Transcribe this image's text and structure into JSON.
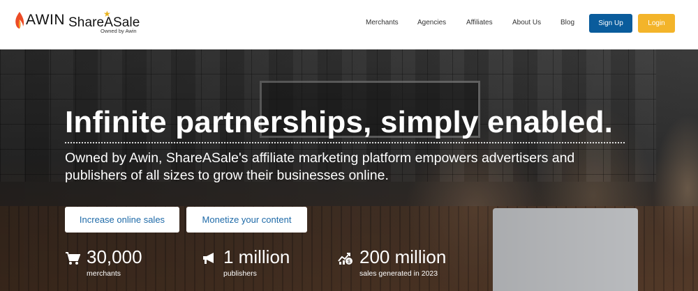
{
  "header": {
    "awin_logo_text": "AWIN",
    "sas_logo_text": "ShareASale",
    "sas_owned_text": "Owned by Awin",
    "nav": [
      {
        "label": "Merchants"
      },
      {
        "label": "Agencies"
      },
      {
        "label": "Affiliates"
      },
      {
        "label": "About Us"
      },
      {
        "label": "Blog"
      }
    ],
    "signup_label": "Sign Up",
    "login_label": "Login"
  },
  "hero": {
    "headline": "Infinite partnerships, simply enabled.",
    "subtext": "Owned by Awin, ShareASale's affiliate marketing platform empowers advertisers and publishers of all sizes to grow their businesses online.",
    "cta_primary": "Increase online sales",
    "cta_secondary": "Monetize your content"
  },
  "stats": [
    {
      "icon": "cart-icon",
      "value": "30,000",
      "label": "merchants"
    },
    {
      "icon": "megaphone-icon",
      "value": "1 million",
      "label": "publishers"
    },
    {
      "icon": "sales-growth-icon",
      "value": "200 million",
      "label": "sales generated in 2023"
    }
  ],
  "colors": {
    "signup_bg": "#0a5c9c",
    "login_bg": "#f3b42a",
    "cta_text": "#1e6aa8",
    "star": "#e8b21d"
  }
}
